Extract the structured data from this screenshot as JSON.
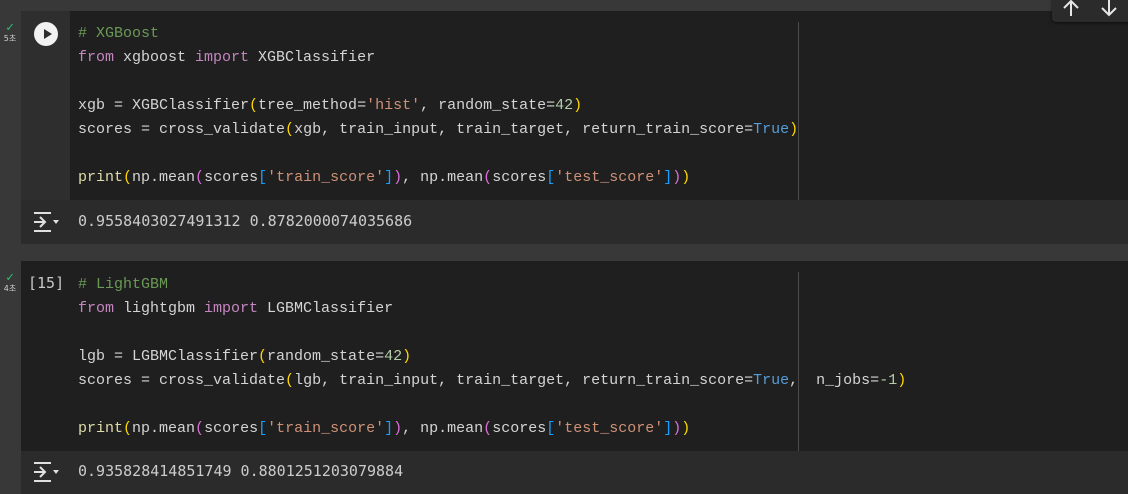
{
  "cells": [
    {
      "status_time": "5초",
      "exec_count": "",
      "output": "0.9558403027491312 0.8782000074035686"
    },
    {
      "status_time": "4초",
      "exec_count": "[15]",
      "output": "0.935828414851749 0.8801251203079884"
    }
  ],
  "code": {
    "c1_comment": "# XGBoost",
    "c2_comment": "# LightGBM",
    "kw_from": "from",
    "kw_import": "import",
    "mod_xgboost": " xgboost ",
    "mod_lightgbm": " lightgbm ",
    "cls_xgb": " XGBClassifier",
    "cls_lgbm": " LGBMClassifier",
    "xgb_assign": "xgb = XGBClassifier",
    "lgb_assign": "lgb = LGBMClassifier",
    "tree_method_kw": "tree_method=",
    "hist_str": "'hist'",
    "sep": ", ",
    "random_state_kw": "random_state=",
    "num_42": "42",
    "scores_assign": "scores = cross_validate",
    "xgb_args": "xgb, train_input, train_target, return_train_score=",
    "lgb_args": "lgb, train_input, train_target, return_train_score=",
    "true_kw": "True",
    "n_jobs_kw": " n_jobs=",
    "num_m1": "-1",
    "print_fn": "print",
    "np_mean1": "np.mean",
    "np_mean2": ", np.mean",
    "scores_var": "scores",
    "train_score_str": "'train_score'",
    "test_score_str": "'test_score'"
  },
  "toolbar": {
    "up_icon": "arrow-up-icon",
    "down_icon": "arrow-down-icon"
  }
}
